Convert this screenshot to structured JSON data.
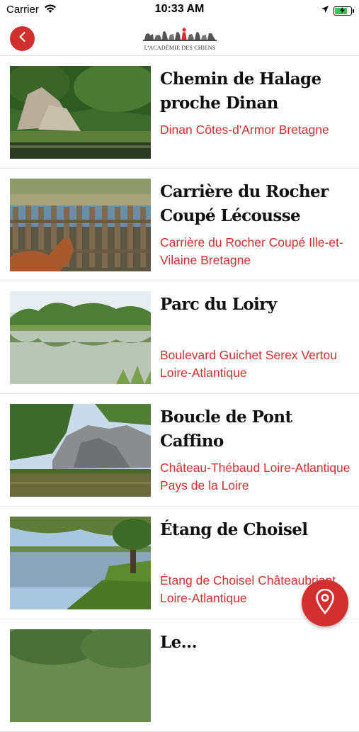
{
  "status_bar": {
    "carrier": "Carrier",
    "time": "10:33 AM",
    "battery_level": 0.85
  },
  "header": {
    "logo_text": "L'ACADÉMIE DES CHIENS",
    "back_icon": "chevron-left-icon"
  },
  "places": [
    {
      "title": "Chemin de Halage proche Dinan",
      "location": "Dinan Côtes-d'Armor Bretagne"
    },
    {
      "title": "Carrière du Rocher Coupé Lécousse",
      "location": "Carrière du Rocher Coupé Ille-et-Vilaine Bretagne"
    },
    {
      "title": "Parc du Loiry",
      "location": "Boulevard Guichet Serex Vertou Loire-Atlantique"
    },
    {
      "title": "Boucle de Pont Caffino",
      "location": "Château-Thébaud Loire-Atlantique Pays de la Loire"
    },
    {
      "title": "Étang de Choisel",
      "location": "Étang de Choisel Châteaubriant Loire-Atlantique"
    },
    {
      "title": "Le…",
      "location": ""
    }
  ],
  "fab": {
    "icon": "map-pin-icon"
  },
  "colors": {
    "accent": "#d32f2f",
    "title": "#111111",
    "divider": "#e6e6e6"
  }
}
